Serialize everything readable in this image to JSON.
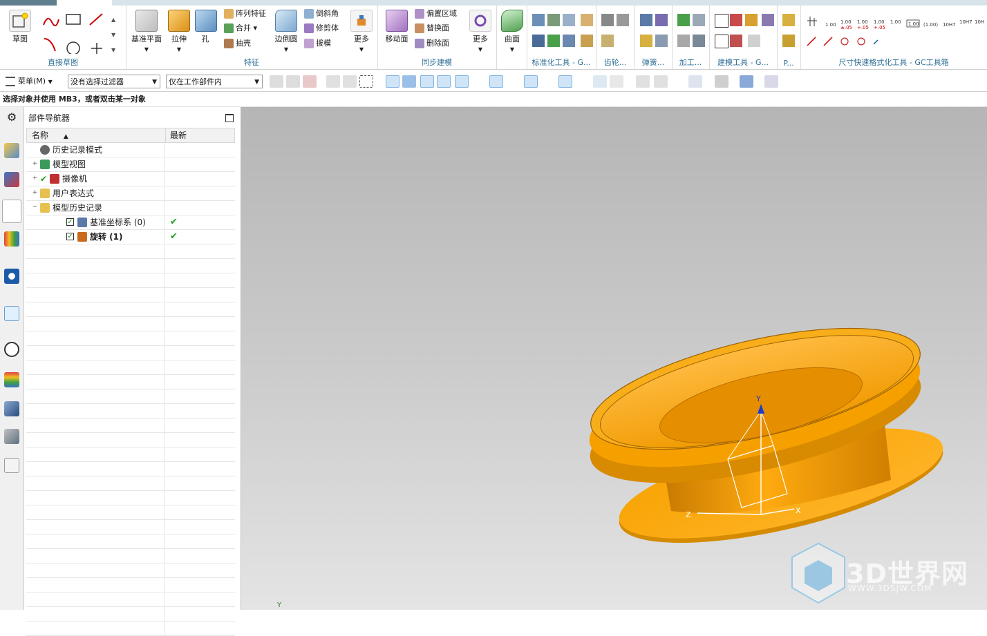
{
  "ribbon": {
    "direct_sketch": {
      "group_label": "直接草图",
      "sketch_label": "草图"
    },
    "feature": {
      "group_label": "特征",
      "datum_plane": "基准平面",
      "extrude": "拉伸",
      "hole": "孔",
      "pattern": "阵列特征",
      "unite": "合并",
      "shell": "抽壳",
      "edge_blend": "边倒圆",
      "chamfer": "倒斜角",
      "trim_body": "修剪体",
      "draft": "拔模",
      "more": "更多"
    },
    "sync": {
      "group_label": "同步建模",
      "move_face": "移动面",
      "offset_region": "偏置区域",
      "replace_face": "替换面",
      "delete_face": "删除面",
      "more": "更多"
    },
    "surface": {
      "label": "曲面"
    },
    "tools": {
      "standard": "标准化工具 - G...",
      "gear": "齿轮...",
      "spring": "弹簧...",
      "machining": "加工...",
      "modeling": "建模工具 - G...",
      "p": "P...",
      "dimension": "尺寸快速格式化工具 - GC工具箱"
    }
  },
  "toolbar": {
    "menu_label": "菜单(M)",
    "filter_value": "没有选择过滤器",
    "scope_value": "仅在工作部件内"
  },
  "status": "选择对象并使用 MB3，或者双击某一对象",
  "navigator": {
    "title": "部件导航器",
    "col_name": "名称",
    "col_latest": "最新",
    "rows": [
      {
        "label": "历史记录模式",
        "icon": "clock-icon"
      },
      {
        "label": "模型视图",
        "icon": "model-view-icon"
      },
      {
        "label": "摄像机",
        "icon": "camera-icon"
      },
      {
        "label": "用户表达式",
        "icon": "folder-icon"
      },
      {
        "label": "模型历史记录",
        "icon": "folder-open-icon"
      },
      {
        "label": "基准坐标系 (0)",
        "icon": "datum-csys-icon",
        "latest": "✔"
      },
      {
        "label": "旋转 (1)",
        "icon": "revolve-icon",
        "latest": "✔"
      }
    ]
  },
  "viewport": {
    "watermark_brand": "3D世界网",
    "watermark_url": "WWW.3DSJW.COM",
    "triad_y": "Y",
    "triad_x": "X",
    "triad_z": "Z",
    "corner_axis": "Y"
  },
  "colors": {
    "part_orange": "#f5a000",
    "group_label_blue": "#2f6f96",
    "check_green": "#1aa01a"
  }
}
